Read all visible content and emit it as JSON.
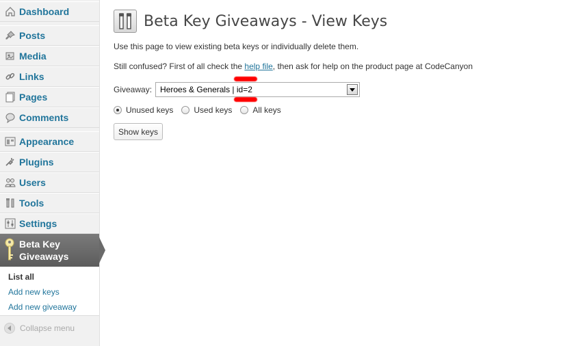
{
  "sidebar": {
    "items": [
      {
        "label": "Dashboard",
        "icon": "dashboard-icon"
      },
      {
        "label": "Posts",
        "icon": "pushpin-icon"
      },
      {
        "label": "Media",
        "icon": "media-icon"
      },
      {
        "label": "Links",
        "icon": "link-icon"
      },
      {
        "label": "Pages",
        "icon": "pages-icon"
      },
      {
        "label": "Comments",
        "icon": "comment-icon"
      },
      {
        "label": "Appearance",
        "icon": "appearance-icon"
      },
      {
        "label": "Plugins",
        "icon": "plug-icon"
      },
      {
        "label": "Users",
        "icon": "users-icon"
      },
      {
        "label": "Tools",
        "icon": "tools-icon"
      },
      {
        "label": "Settings",
        "icon": "settings-icon"
      }
    ],
    "active": {
      "line1": "Beta Key",
      "line2": "Giveaways",
      "icon": "key-icon"
    },
    "submenu": [
      "List all",
      "Add new keys",
      "Add new giveaway"
    ],
    "collapse_label": "Collapse menu"
  },
  "main": {
    "title": "Beta Key Giveaways - View Keys",
    "intro": "Use this page to view existing beta keys or individually delete them.",
    "help_prefix": "Still confused? First of all check the ",
    "help_link": "help file",
    "help_suffix": ", then ask for help on the product page at CodeCanyon",
    "giveaway_label": "Giveaway:",
    "giveaway_value": "Heroes & Generals | id=2",
    "radios": [
      {
        "label": "Unused keys",
        "checked": true
      },
      {
        "label": "Used keys",
        "checked": false
      },
      {
        "label": "All keys",
        "checked": false
      }
    ],
    "show_button": "Show keys"
  },
  "colors": {
    "link": "#21759b",
    "sidebar_bg": "#f1f1f1",
    "active_bg": "#6a6a6a",
    "redaction": "#ff0000"
  }
}
